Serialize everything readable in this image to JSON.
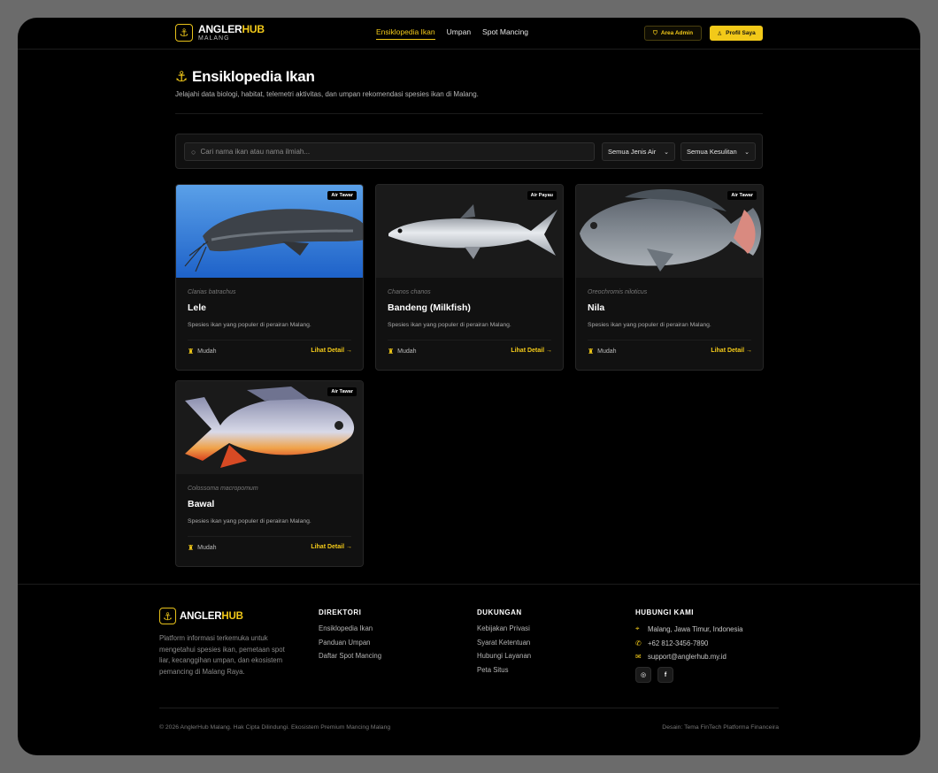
{
  "header": {
    "brand_main": "ANGLER",
    "brand_accent": "HUB",
    "brand_sub": "MALANG",
    "nav": [
      {
        "label": "Ensiklopedia Ikan",
        "active": true
      },
      {
        "label": "Umpan",
        "active": false
      },
      {
        "label": "Spot Mancing",
        "active": false
      }
    ],
    "admin_label": "Area Admin",
    "profile_label": "Profil Saya"
  },
  "page": {
    "title": "Ensiklopedia Ikan",
    "subtitle": "Jelajahi data biologi, habitat, telemetri aktivitas, dan umpan rekomendasi spesies ikan di Malang."
  },
  "filters": {
    "search_placeholder": "Cari nama ikan atau nama ilmiah...",
    "water_type": "Semua Jenis Air",
    "difficulty": "Semua Kesulitan"
  },
  "fish": [
    {
      "badge": "Air Tawar",
      "scientific": "Clarias batrachus",
      "name": "Lele",
      "desc": "Spesies ikan yang populer di perairan Malang.",
      "difficulty": "Mudah",
      "detail": "Lihat Detail →",
      "image": "catfish"
    },
    {
      "badge": "Air Payau",
      "scientific": "Chanos chanos",
      "name": "Bandeng (Milkfish)",
      "desc": "Spesies ikan yang populer di perairan Malang.",
      "difficulty": "Mudah",
      "detail": "Lihat Detail →",
      "image": "milkfish"
    },
    {
      "badge": "Air Tawar",
      "scientific": "Oreochromis niloticus",
      "name": "Nila",
      "desc": "Spesies ikan yang populer di perairan Malang.",
      "difficulty": "Mudah",
      "detail": "Lihat Detail →",
      "image": "tilapia"
    },
    {
      "badge": "Air Tawar",
      "scientific": "Colossoma macropomum",
      "name": "Bawal",
      "desc": "Spesies ikan yang populer di perairan Malang.",
      "difficulty": "Mudah",
      "detail": "Lihat Detail →",
      "image": "pomfret"
    }
  ],
  "footer": {
    "brand_main": "ANGLER",
    "brand_accent": "HUB",
    "about": "Platform informasi terkemuka untuk mengetahui spesies ikan, pemetaan spot liar, kecanggihan umpan, dan ekosistem pemancing di Malang Raya.",
    "direktori": {
      "title": "DIREKTORI",
      "links": [
        "Ensiklopedia Ikan",
        "Panduan Umpan",
        "Daftar Spot Mancing"
      ]
    },
    "dukungan": {
      "title": "DUKUNGAN",
      "links": [
        "Kebijakan Privasi",
        "Syarat Ketentuan",
        "Hubungi Layanan",
        "Peta Situs"
      ]
    },
    "kontak": {
      "title": "HUBUNGI KAMI",
      "address": "Malang, Jawa Timur, Indonesia",
      "phone": "+62 812-3456-7890",
      "email": "support@anglerhub.my.id"
    },
    "copyright": "© 2026 AnglerHub Malang. Hak Cipta Dilindungi. Ekosistem Premium Mancing Malang",
    "credit": "Desain: Tema FinTech Platforma Financeira"
  },
  "colors": {
    "accent": "#f2c919",
    "background": "#000000",
    "card": "#111111"
  }
}
